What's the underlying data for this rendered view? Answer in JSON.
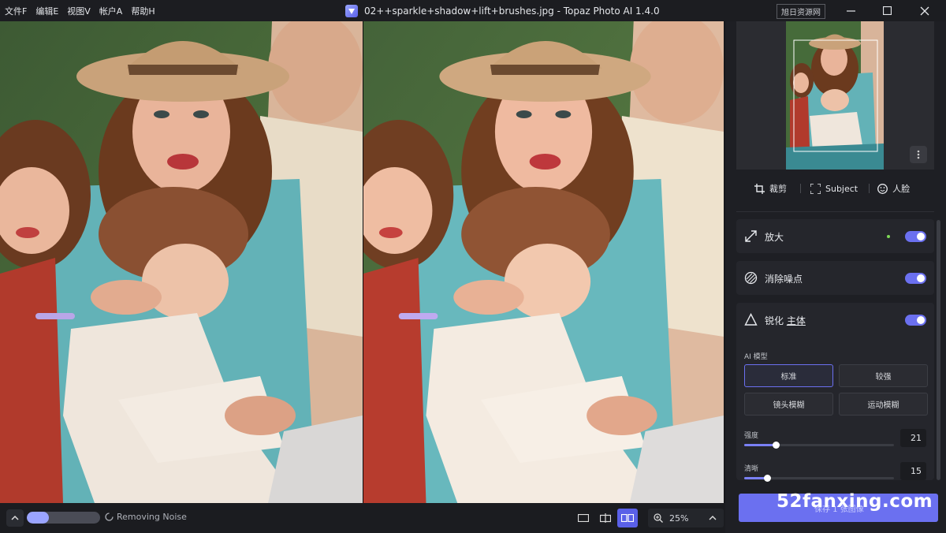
{
  "titlebar": {
    "menus": [
      "文件F",
      "编辑E",
      "视图V",
      "帐户A",
      "帮助H"
    ],
    "title": "02++sparkle+shadow+lift+brushes.jpg - Topaz Photo AI 1.4.0",
    "badge": "旭日资源网"
  },
  "bottom": {
    "progress": 0.3,
    "status": "Removing Noise",
    "zoom": "25%"
  },
  "panel": {
    "tabs": [
      {
        "label": "裁剪",
        "icon": "crop-icon"
      },
      {
        "label": "Subject",
        "icon": "subject-select-icon"
      },
      {
        "label": "人脸",
        "icon": "face-icon"
      }
    ],
    "sections": [
      {
        "title": "放大",
        "icon": "upscale-icon",
        "enabled": true
      },
      {
        "title": "消除噪点",
        "icon": "denoise-icon",
        "enabled": true
      },
      {
        "title": "锐化",
        "title_suffix": "主体",
        "icon": "sharpen-icon",
        "enabled": true
      }
    ],
    "ai_model_label": "AI 模型",
    "models": [
      "标准",
      "较强",
      "镜头模糊",
      "运动模糊"
    ],
    "selected_model": "标准",
    "sliders": [
      {
        "label": "强度",
        "value": 21
      },
      {
        "label": "清晰",
        "value": 15
      }
    ],
    "save_label": "保存 1 张图像"
  },
  "watermark": "52fanxing.com",
  "colors": {
    "accent": "#6b70f0",
    "panel": "#1e1f24",
    "background": "#17181c"
  }
}
